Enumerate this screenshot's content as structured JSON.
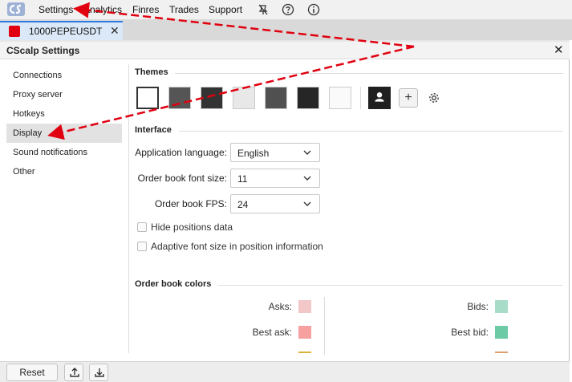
{
  "topbar": {
    "menu": [
      "Settings",
      "Analytics",
      "Finres",
      "Trades",
      "Support"
    ],
    "logo_icon": "cscalp-logo-icon",
    "icons": [
      "mute-icon",
      "help-icon",
      "info-icon"
    ]
  },
  "tab": {
    "label": "1000PEPEUSDT",
    "color": "#e00010"
  },
  "dialog": {
    "title": "CScalp Settings",
    "nav": [
      "Connections",
      "Proxy server",
      "Hotkeys",
      "Display",
      "Sound notifications",
      "Other"
    ],
    "active_nav": "Display",
    "themes": {
      "title": "Themes",
      "swatches": [
        "#ffffff",
        "#555555",
        "#333333",
        "#e8e8e8",
        "#505050",
        "#262626",
        "#fafafa"
      ],
      "selected_index": 0,
      "custom_icon": "user-theme-icon",
      "add_icon": "plus-icon",
      "settings_icon": "gear-icon"
    },
    "interface": {
      "title": "Interface",
      "language_label": "Application language:",
      "language_value": "English",
      "font_size_label": "Order book font size:",
      "font_size_value": "11",
      "fps_label": "Order book FPS:",
      "fps_value": "24",
      "hide_positions_label": "Hide positions data",
      "hide_positions_checked": false,
      "adaptive_font_label": "Adaptive font size in position information",
      "adaptive_font_checked": false
    },
    "orderbook_colors": {
      "title": "Order book colors",
      "asks_label": "Asks:",
      "asks_color": "#f2c7c7",
      "best_ask_label": "Best ask:",
      "best_ask_color": "#f7a0a0",
      "bids_label": "Bids:",
      "bids_color": "#a6dcc8",
      "best_bid_label": "Best bid:",
      "best_bid_color": "#6ccaa5"
    }
  },
  "bottom": {
    "reset_label": "Reset",
    "upload_icon": "upload-icon",
    "download_icon": "download-icon"
  },
  "annotation_color": "#e00010"
}
